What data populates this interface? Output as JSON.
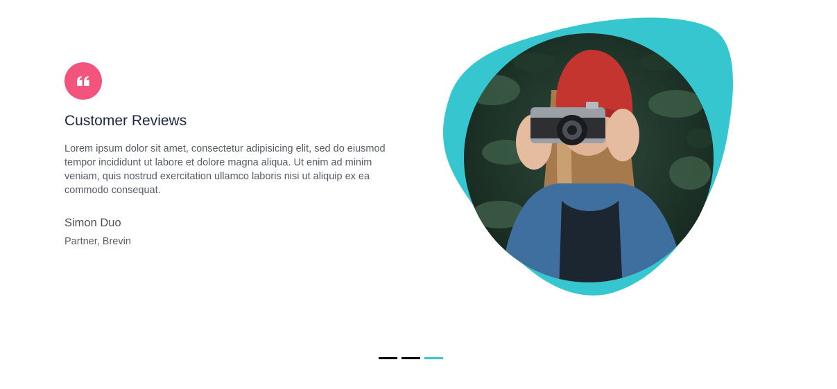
{
  "testimonial": {
    "quote_icon": "quote-left-icon",
    "heading": "Customer Reviews",
    "text": "Lorem ipsum dolor sit amet, consectetur adipisicing elit, sed do eiusmod tempor incididunt ut labore et dolore magna aliqua. Ut enim ad minim veniam, quis nostrud exercitation ullamco laboris nisi ut aliquip ex ea commodo consequat.",
    "author_name": "Simon Duo",
    "author_role": "Partner, Brevin"
  },
  "photo": {
    "subject": "woman in red beanie holding a camera"
  },
  "pager": {
    "slide_count": 3,
    "active_index": 2
  },
  "colors": {
    "accent_pink": "#f2547d",
    "accent_teal": "#36c6cf",
    "heading": "#1b2544",
    "pager_inactive": "#000000"
  }
}
